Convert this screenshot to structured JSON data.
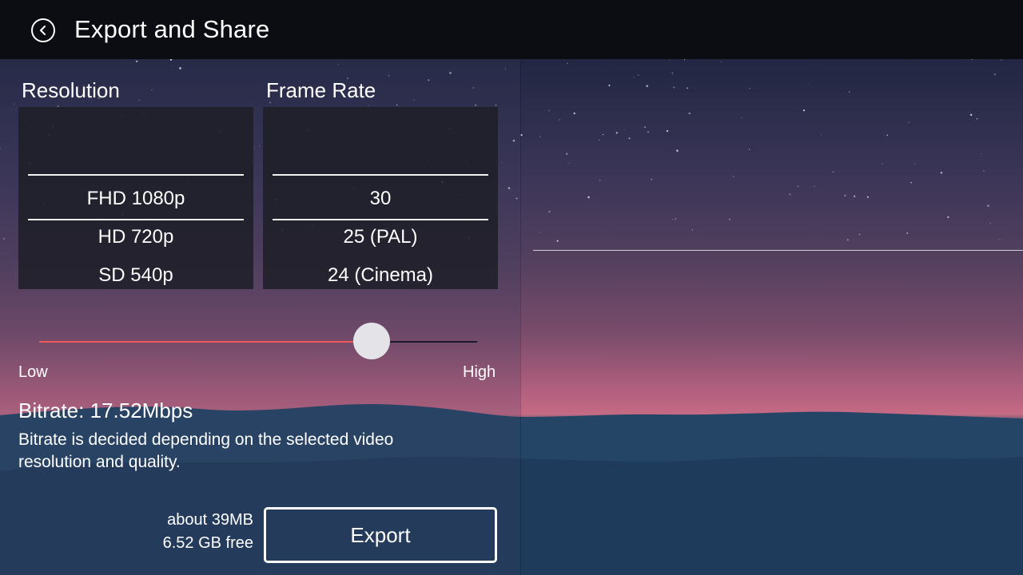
{
  "header": {
    "title": "Export and Share",
    "back_icon": "back-arrow-icon"
  },
  "resolution": {
    "label": "Resolution",
    "options": [
      "FHD 1080p",
      "HD 720p",
      "SD 540p"
    ],
    "selected": "FHD 1080p"
  },
  "frame_rate": {
    "label": "Frame Rate",
    "options": [
      "30",
      "25 (PAL)",
      "24 (Cinema)"
    ],
    "selected": "30"
  },
  "quality": {
    "low_label": "Low",
    "high_label": "High",
    "value_fraction": 0.76,
    "fill_color": "#ef5a5a"
  },
  "bitrate": {
    "value": "Bitrate: 17.52Mbps",
    "description": "Bitrate is decided depending on the selected video resolution and quality."
  },
  "storage": {
    "estimated_size": "about 39MB",
    "free_space": "6.52 GB free"
  },
  "export_button": {
    "label": "Export"
  }
}
